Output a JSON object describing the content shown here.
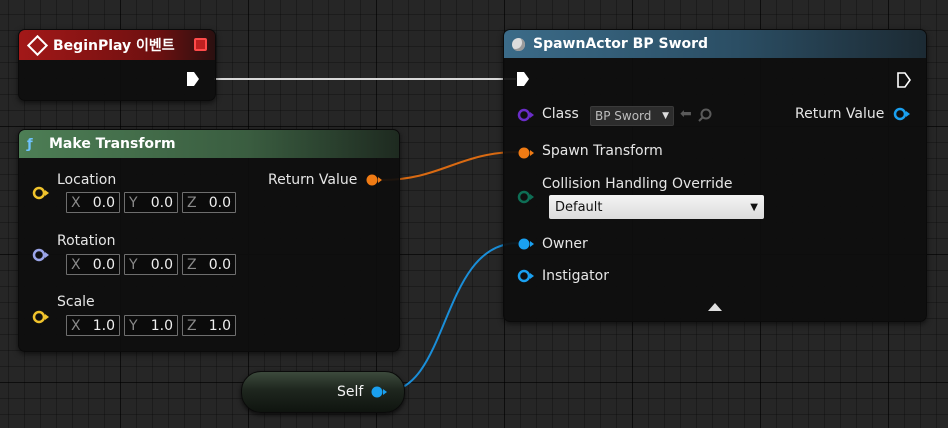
{
  "begin_play": {
    "title": "BeginPlay 이벤트"
  },
  "make_transform": {
    "title": "Make Transform",
    "return_label": "Return Value",
    "rows": [
      {
        "label": "Location",
        "x": "0.0",
        "y": "0.0",
        "z": "0.0"
      },
      {
        "label": "Rotation",
        "x": "0.0",
        "y": "0.0",
        "z": "0.0"
      },
      {
        "label": "Scale",
        "x": "1.0",
        "y": "1.0",
        "z": "1.0"
      }
    ],
    "axis_labels": {
      "x": "X",
      "y": "Y",
      "z": "Z"
    }
  },
  "spawn_actor": {
    "title": "SpawnActor BP Sword",
    "class_label": "Class",
    "class_value": "BP Sword",
    "return_label": "Return Value",
    "spawn_transform_label": "Spawn Transform",
    "collision_label": "Collision Handling Override",
    "collision_value": "Default",
    "owner_label": "Owner",
    "instigator_label": "Instigator"
  },
  "self_node": {
    "label": "Self"
  },
  "colors": {
    "exec": "#ffffff",
    "struct_vector": "#f0c32c",
    "struct_rotator": "#9ba5e8",
    "struct_transform": "#f07b14",
    "object": "#1aa0f0",
    "class": "#6a2dc8",
    "enum": "#0e6e55",
    "event_header": "#8a1414",
    "function_header": "#3d6b45",
    "spawn_header": "#2b4e64"
  },
  "icons": {
    "event": "event-diamond-icon",
    "function": "function-f-icon",
    "spawn": "spawn-actor-icon"
  }
}
